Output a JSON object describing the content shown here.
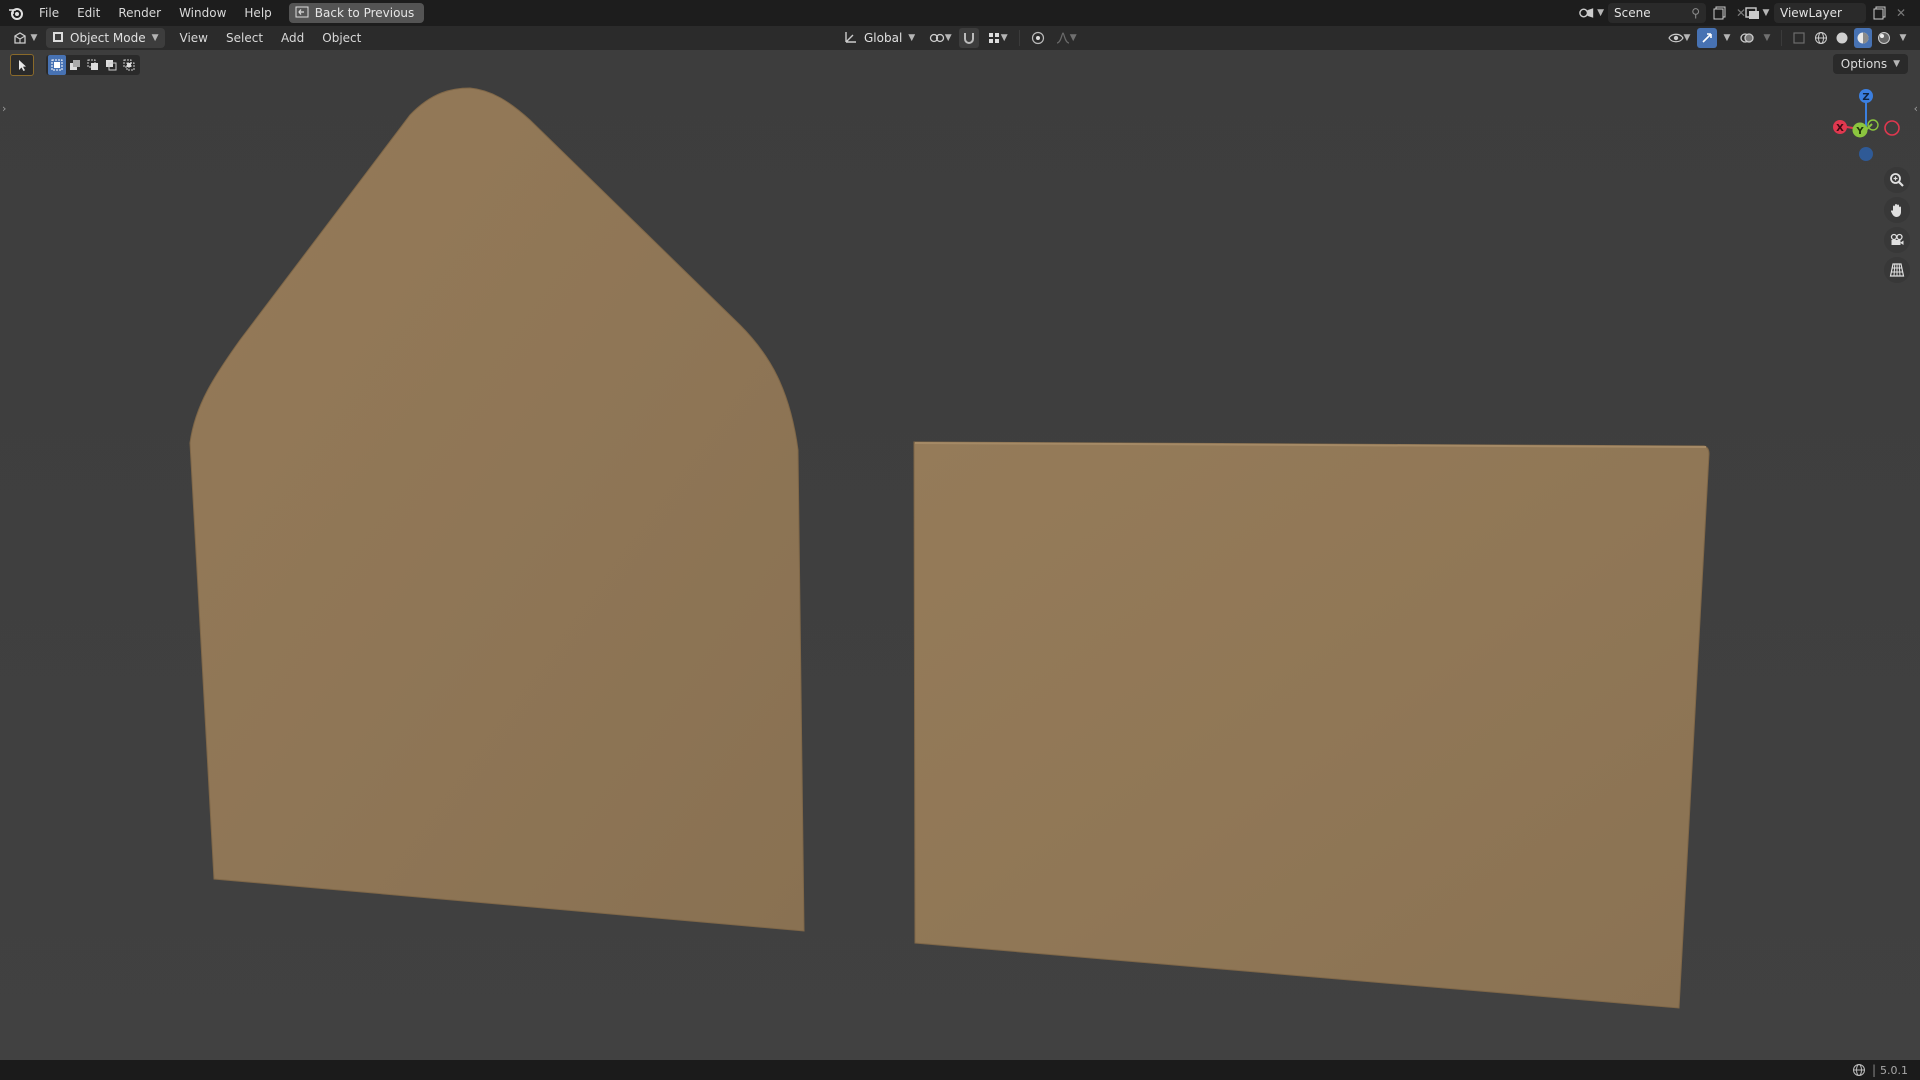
{
  "topbar": {
    "menus": [
      "File",
      "Edit",
      "Render",
      "Window",
      "Help"
    ],
    "back_button": "Back to Previous",
    "scene_label": "Scene",
    "view_layer_label": "ViewLayer"
  },
  "header": {
    "mode": "Object Mode",
    "menus": [
      "View",
      "Select",
      "Add",
      "Object"
    ],
    "transform_orientation": "Global"
  },
  "viewport": {
    "options_label": "Options",
    "gizmo": {
      "x": "X",
      "y": "Y",
      "z": "Z"
    },
    "objects": [
      {
        "name": "envelope-back-with-flap",
        "color": "#8f7656"
      },
      {
        "name": "envelope-front-panel",
        "color": "#8f7656"
      }
    ],
    "background_color": "#3f3f3f"
  },
  "status": {
    "version": "5.0.1"
  },
  "colors": {
    "accent_blue": "#4772b3",
    "axis_x": "#e0384f",
    "axis_y": "#8bc53f",
    "axis_z": "#3b7fe0"
  }
}
